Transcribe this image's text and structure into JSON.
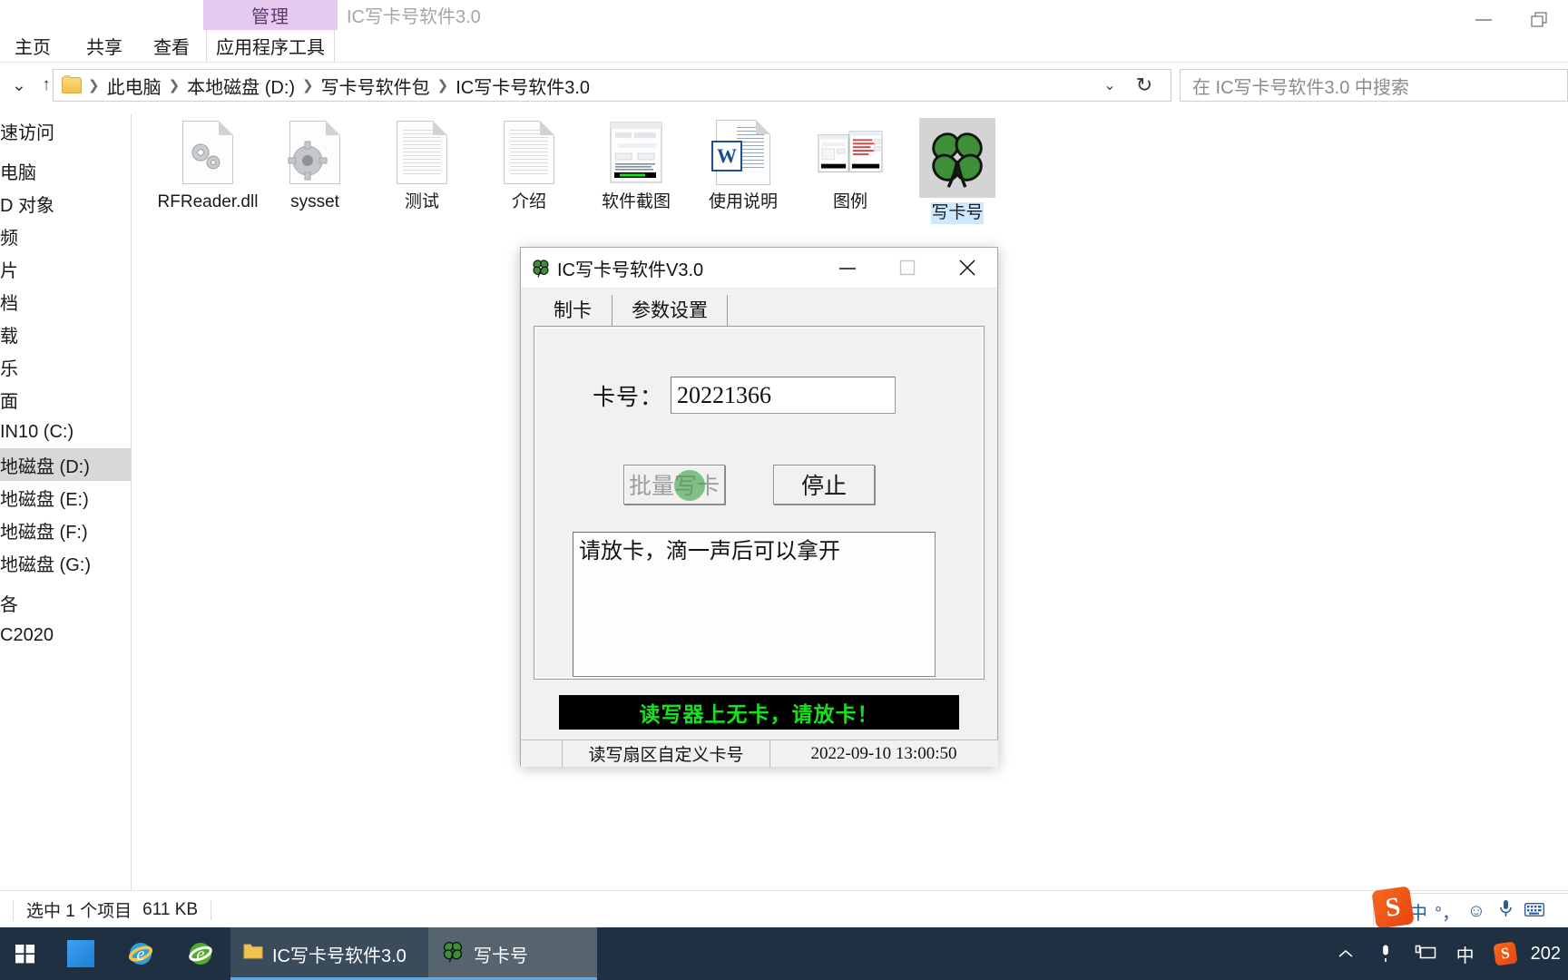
{
  "explorer": {
    "contextual_tab": "管理",
    "window_title": "IC写卡号软件3.0",
    "tabs": [
      {
        "label": "主页"
      },
      {
        "label": "共享"
      },
      {
        "label": "查看"
      },
      {
        "label": "应用程序工具"
      }
    ],
    "window_controls": {
      "minimize": "minimize-icon",
      "restore": "restore-icon"
    },
    "address": {
      "breadcrumbs": [
        "此电脑",
        "本地磁盘 (D:)",
        "写卡号软件包",
        "IC写卡号软件3.0"
      ],
      "separator": "❯",
      "dropdown": "chevron-down-icon",
      "refresh": "refresh-icon"
    },
    "search": {
      "placeholder": "在 IC写卡号软件3.0 中搜索"
    },
    "sidebar": [
      {
        "label": "速访问",
        "selected": false
      },
      {
        "label": "电脑",
        "selected": false
      },
      {
        "label": "D 对象",
        "selected": false
      },
      {
        "label": "频",
        "selected": false
      },
      {
        "label": "片",
        "selected": false
      },
      {
        "label": "档",
        "selected": false
      },
      {
        "label": "载",
        "selected": false
      },
      {
        "label": "乐",
        "selected": false
      },
      {
        "label": "面",
        "selected": false
      },
      {
        "label": "IN10 (C:)",
        "selected": false
      },
      {
        "label": "地磁盘 (D:)",
        "selected": true
      },
      {
        "label": "地磁盘 (E:)",
        "selected": false
      },
      {
        "label": "地磁盘 (F:)",
        "selected": false
      },
      {
        "label": "地磁盘 (G:)",
        "selected": false
      },
      {
        "label": "各",
        "selected": false
      },
      {
        "label": "C2020",
        "selected": false
      }
    ],
    "files": [
      {
        "name": "RFReader.dll",
        "icon": "gears-document-icon",
        "selected": false
      },
      {
        "name": "sysset",
        "icon": "gear-document-icon",
        "selected": false
      },
      {
        "name": "测试",
        "icon": "text-document-icon",
        "selected": false
      },
      {
        "name": "介绍",
        "icon": "text-document-icon",
        "selected": false
      },
      {
        "name": "软件截图",
        "icon": "screenshot-image-icon",
        "selected": false
      },
      {
        "name": "使用说明",
        "icon": "word-document-icon",
        "selected": false
      },
      {
        "name": "图例",
        "icon": "screenshot-image-icon",
        "selected": false
      },
      {
        "name": "写卡号",
        "icon": "clover-app-icon",
        "selected": true
      }
    ],
    "status": {
      "selection": "选中 1 个项目",
      "size": "611 KB"
    }
  },
  "dialog": {
    "title": "IC写卡号软件V3.0",
    "icon": "clover-app-icon",
    "controls": {
      "minimize": "minimize-icon",
      "maximize": "maximize-icon",
      "close": "close-icon"
    },
    "tabs": [
      {
        "label": "制卡",
        "active": true
      },
      {
        "label": "参数设置",
        "active": false
      }
    ],
    "card_field": {
      "label": "卡号：",
      "value": "20221366"
    },
    "buttons": [
      {
        "label": "批量写卡",
        "disabled": true,
        "name": "batch-write-button"
      },
      {
        "label": "停止",
        "disabled": false,
        "name": "stop-button"
      }
    ],
    "log_text": "请放卡，滴一声后可以拿开",
    "led_message": "读写器上无卡，请放卡！",
    "led_color": "#19e01d",
    "status": {
      "left": "",
      "middle": "读写扇区自定义卡号",
      "right": "2022-09-10 13:00:50"
    }
  },
  "taskbar": {
    "start": "windows-start-icon",
    "pinned": [
      {
        "name": "task-view-icon",
        "label": ""
      },
      {
        "name": "internet-explorer-icon",
        "label": ""
      },
      {
        "name": "browser-green-icon",
        "label": ""
      }
    ],
    "tasks": [
      {
        "label": "IC写卡号软件3.0",
        "icon": "folder-icon"
      },
      {
        "label": "写卡号",
        "icon": "clover-app-icon"
      }
    ],
    "tray": {
      "expand": "chevron-up-icon",
      "icons": [
        "microphone-icon",
        "display-icon",
        "ime-chinese-icon",
        "sogou-icon"
      ],
      "clock": "202"
    }
  },
  "ime": {
    "logo": "S",
    "items": [
      "中",
      "°，",
      "☺",
      "🎤",
      "⌨"
    ]
  }
}
